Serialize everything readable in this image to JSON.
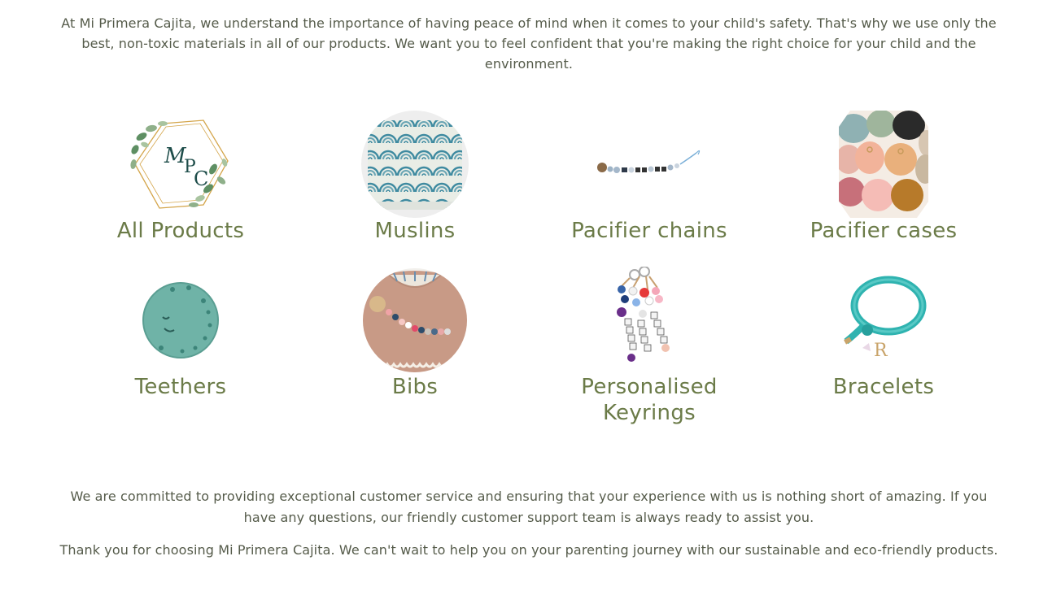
{
  "intro_text": "At Mi Primera Cajita, we understand the importance of having peace of mind when it comes to your child's safety. That's why we use only the best, non-toxic materials in all of our products. We want you to feel confident that you're making the right choice for your child and the environment.",
  "categories": [
    {
      "label": "All Products",
      "icon": "mpc-logo-icon"
    },
    {
      "label": "Muslins",
      "icon": "muslin-image"
    },
    {
      "label": "Pacifier chains",
      "icon": "pacifier-chain-image"
    },
    {
      "label": "Pacifier cases",
      "icon": "pacifier-cases-image"
    },
    {
      "label": "Teethers",
      "icon": "teether-image"
    },
    {
      "label": "Bibs",
      "icon": "bib-image"
    },
    {
      "label": "Personalised Keyrings",
      "icon": "keyrings-image"
    },
    {
      "label": "Bracelets",
      "icon": "bracelet-image"
    }
  ],
  "logo_text": "MPC",
  "outro_1": "We are committed to providing exceptional customer service and ensuring that your experience with us is nothing short of amazing. If you have any questions, our friendly customer support team is always ready to assist you.",
  "outro_2": "Thank you for choosing Mi Primera Cajita. We can't wait to help you on your parenting journey with our sustainable and eco-friendly products.",
  "colors": {
    "label": "#6b7b48",
    "text": "#555b4a"
  }
}
